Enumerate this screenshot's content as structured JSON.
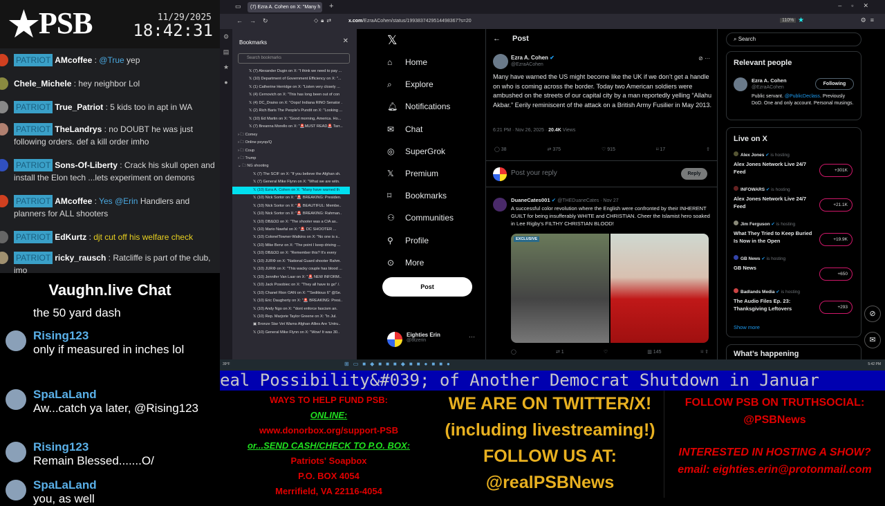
{
  "stream": {
    "logo": "PSB",
    "date": "11/29/2025",
    "time": "18:42:31"
  },
  "chat_top": [
    {
      "badge": "PATRIOT",
      "user": "AMcoffee",
      "mention": "@True",
      "text": " yep",
      "color": "#d04020"
    },
    {
      "badge": "",
      "user": "Chele_Michele",
      "mention": "",
      "text": "hey neighbor Lol",
      "color": "#8a8a40"
    },
    {
      "badge": "PATRIOT",
      "user": "True_Patriot",
      "mention": "",
      "text": "5 kids too in apt in WA",
      "color": "#888"
    },
    {
      "badge": "PATRIOT",
      "user": "TheLandrys",
      "mention": "",
      "text": "no DOUBT he was just following orders. def a kill order imho",
      "color": "#b08070"
    },
    {
      "badge": "PATRIOT",
      "user": "Sons-Of-Liberty",
      "mention": "",
      "text": "Crack his skull open and install the Elon tech ...lets experiment on demons",
      "color": "#3050c0"
    },
    {
      "badge": "PATRIOT",
      "user": "AMcoffee",
      "mention": "Yes @Erin",
      "text": " Handlers and planners for ALL shooters",
      "color": "#d04020"
    },
    {
      "badge": "PATRIOT",
      "user": "EdKurtz",
      "mention": "",
      "text": "djt cut off his welfare check",
      "color": "#666",
      "yellow": true
    },
    {
      "badge": "PATRIOT",
      "user": "ricky_rausch",
      "mention": "",
      "text": "Ratcliffe is part of the club, imo",
      "color": "#a09070"
    }
  ],
  "vaughn": {
    "title": "Vaughn.live Chat",
    "continuation": "the 50 yard dash",
    "messages": [
      {
        "user": "Rising123",
        "text": "only if measured in inches lol"
      },
      {
        "user": "SpaLaLand",
        "text": "Aw...catch ya later, @Rising123"
      },
      {
        "user": "Rising123",
        "text": "Remain Blessed.......O/"
      },
      {
        "user": "SpaLaLand",
        "text": "you, as well"
      }
    ]
  },
  "browser": {
    "tab": "(7) Ezra A. Cohen on X: \"Many h",
    "url_host": "x.com",
    "url_path": "/EzraACohen/status/1993837429514498367?s=20",
    "zoom": "110%"
  },
  "bookmarks": {
    "title": "Bookmarks",
    "search_placeholder": "Search bookmarks",
    "items": [
      {
        "t": "x",
        "l": "(7) Alexander Dugin on X: \"I think we need to pay ..."
      },
      {
        "t": "x",
        "l": "(10) Department of Government Efficiency on X: \"..."
      },
      {
        "t": "x",
        "l": "(1) Catherine Herridge on X: \"Listen very closely ..."
      },
      {
        "t": "x",
        "l": "(4) Cernovich on X: \"This has long been out of con"
      },
      {
        "t": "x",
        "l": "(4) DC_Draino on X: \"Oops! Indiana RINO Senator ."
      },
      {
        "t": "x",
        "l": "(2) Rich Baris The People's Pundit on X: \"Looking ..."
      },
      {
        "t": "x",
        "l": "(10) Ed Martin on X: \"Good morning, America. Ho..."
      },
      {
        "t": "x",
        "l": "(7) Breanna Morello on X: \"🚨MUST READ🚨 Tarr..."
      },
      {
        "t": "f",
        "l": "Comey"
      },
      {
        "t": "f",
        "l": "Online psyop/Q"
      },
      {
        "t": "f",
        "l": "Coup"
      },
      {
        "t": "f",
        "l": "Trump"
      },
      {
        "t": "o",
        "l": "NG shooting"
      },
      {
        "t": "c",
        "l": "(7) The SCIF on X: \"If you believe the Afghan sh."
      },
      {
        "t": "c",
        "l": "(7) General Mike Flynn on X: \"What we are witn."
      },
      {
        "t": "s",
        "l": "(10) Ezra A. Cohen on X: \"Many have warned th"
      },
      {
        "t": "c",
        "l": "(10) Nick Sortor on X: \"🚨 BREAKING: Presiden."
      },
      {
        "t": "c",
        "l": "(10) Nick Sortor on X: \"🚨 BEAUTIFUL: Membe.."
      },
      {
        "t": "c",
        "l": "(10) Nick Sortor on X: \"🚨 BREAKING: Rahman.."
      },
      {
        "t": "c",
        "l": "(10) DBΔΩΩ on X: \"The shooter was a CIA as.."
      },
      {
        "t": "c",
        "l": "(10) Mario Nawfal on X: \"🚨 DC SHOOTER ..."
      },
      {
        "t": "c",
        "l": "(10) ColonelTowner-Watkins on X: \"No one is s.."
      },
      {
        "t": "c",
        "l": "(10) Mike Benz on X: \"The point I keep driving ..."
      },
      {
        "t": "c",
        "l": "(10) DBΔΩΩ on X: \"Remember this? It's every"
      },
      {
        "t": "c",
        "l": "(10) JURΦ on X: \"National Guard shooter Rahm."
      },
      {
        "t": "c",
        "l": "(10) JURΦ on X: \"This wacky couple has blood ..."
      },
      {
        "t": "c",
        "l": "(10) Jennifer Van Laar on X: \"🚨 NEW INFORM.."
      },
      {
        "t": "c",
        "l": "(10) Jack Posobiec on X: \"They all have to go\" /."
      },
      {
        "t": "c",
        "l": "(10) Chanel Rion OAN on X: \"\"Seditious 6\" @Se."
      },
      {
        "t": "c",
        "l": "(10) Eric Daugherty on X: \"🚨 BREAKING: Presi.."
      },
      {
        "t": "c",
        "l": "(10) Andy Ngo on X: \"'dont enforce fascism an."
      },
      {
        "t": "c",
        "l": "(10) Rep. Marjorie Taylor Greene on X: \"In Jul."
      },
      {
        "t": "b",
        "l": "Bronze Star Vet Warns Afghan Allies Are 'Untru.."
      },
      {
        "t": "c",
        "l": "(10) General Mike Flynn on X: \"Wow! It was 30.."
      }
    ]
  },
  "x_nav": {
    "items": [
      {
        "icon": "home-icon",
        "g": "⌂",
        "label": "Home"
      },
      {
        "icon": "search-icon",
        "g": "⌕",
        "label": "Explore"
      },
      {
        "icon": "bell-icon",
        "g": "🔔︎",
        "label": "Notifications"
      },
      {
        "icon": "mail-icon",
        "g": "✉",
        "label": "Chat"
      },
      {
        "icon": "grok-icon",
        "g": "◎",
        "label": "SuperGrok"
      },
      {
        "icon": "x-icon",
        "g": "𝕏",
        "label": "Premium"
      },
      {
        "icon": "bookmark-icon",
        "g": "⌑",
        "label": "Bookmarks"
      },
      {
        "icon": "communities-icon",
        "g": "⚇",
        "label": "Communities"
      },
      {
        "icon": "profile-icon",
        "g": "⚲",
        "label": "Profile"
      },
      {
        "icon": "more-icon",
        "g": "⊙",
        "label": "More"
      }
    ],
    "post_label": "Post",
    "me_name": "Eighties Erin",
    "me_handle": "@8tzerin"
  },
  "post": {
    "header": "Post",
    "author": "Ezra A. Cohen",
    "handle": "@EzraACohen",
    "text": "Many have warned the US might become like the UK if we don’t get a handle on who is coming across the border. Today two American soldiers were ambushed on the streets of our capital city by a man reportedly yelling “Allahu Akbar.” Eerily reminiscent of the attack on a British Army Fusilier in May 2013.",
    "time": "6:21 PM · Nov 26, 2025 · ",
    "views": "20.4K",
    "views_label": " Views",
    "replies": "38",
    "reposts": "375",
    "likes": "915",
    "bookmarks": "17",
    "reply_placeholder": "Post your reply",
    "reply_button": "Reply"
  },
  "reply": {
    "author": "DuaneCates001",
    "handle": "@THEDuaneCates · Nov 27",
    "text": "A successful color revolution where the English were confronted by their INHERENT GUILT for being insufferably WHITE and CHRISTIAN. Cheer the Islamist hero soaked in Lee Rigby's FILTHY CHRISTIAN BLOOD!",
    "badge": "EXCLUSIVE",
    "reposts": "1",
    "views": "145"
  },
  "right": {
    "search_placeholder": "Search",
    "relevant_title": "Relevant people",
    "person": {
      "name": "Ezra A. Cohen",
      "handle": "@EzraACohen",
      "button": "Following",
      "bio_a": "Public servant. ",
      "bio_link": "@PublicDeclass",
      "bio_b": ". Previously DoD. One and only account. Personal musings."
    },
    "live_title": "Live on X",
    "live": [
      {
        "host": "Alex Jones",
        "hosting": " is hosting",
        "title": "Alex Jones Network Live 24/7 Feed",
        "count": "+301K"
      },
      {
        "host": "INFOWARS",
        "hosting": " is hosting",
        "title": "Alex Jones Network Live 24/7 Feed",
        "count": "+21.1K"
      },
      {
        "host": "Jim Ferguson",
        "hosting": " is hosting",
        "title": "What They Tried to Keep Buried Is Now in the Open",
        "count": "+19.9K"
      },
      {
        "host": "GB News",
        "hosting": " is hosting",
        "title": "GB News",
        "count": "+650"
      },
      {
        "host": "Badlands Media",
        "hosting": " is hosting",
        "title": "The Audio Files Ep. 23: Thanksgiving Leftovers",
        "count": "+293"
      }
    ],
    "show_more": "Show more",
    "happening": "What’s happening"
  },
  "taskbar": {
    "weather": "39°F",
    "time": "5:42 PM"
  },
  "ticker": "eal Possibility&#039; of Another Democrat Shutdown in Januar",
  "overlay": {
    "fund": [
      "WAYS TO HELP FUND PSB:",
      "ONLINE:",
      "www.donorbox.org/support-PSB",
      "or...SEND CASH/CHECK TO P.O. BOX:",
      "Patriots' Soapbox",
      "P.O. BOX 4054",
      "Merrifield, VA 22116-4054"
    ],
    "twitter": [
      "WE ARE ON TWITTER/X!",
      "(including livestreaming!)",
      "FOLLOW US AT:",
      "@realPSBNews"
    ],
    "truth": [
      "FOLLOW PSB ON TRUTHSOCIAL:",
      "@PSBNews",
      "INTERESTED IN HOSTING A SHOW?",
      "email: eighties.erin@protonmail.com"
    ]
  }
}
